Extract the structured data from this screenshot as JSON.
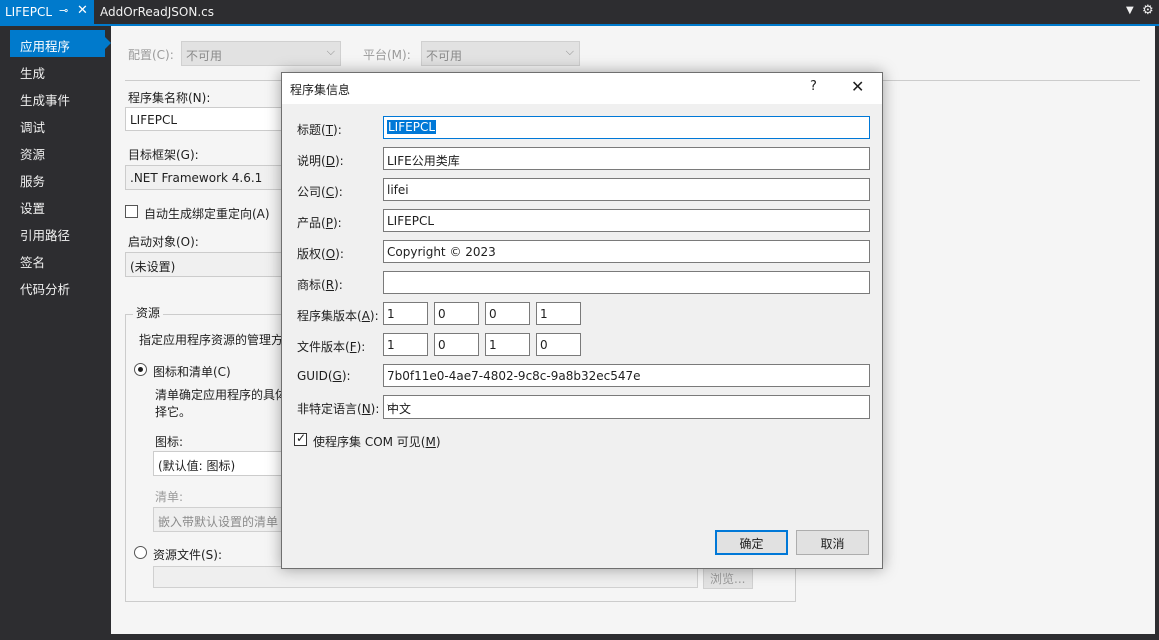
{
  "tabs": {
    "active_label": "LIFEPCL",
    "inactive_label": "AddOrReadJSON.cs"
  },
  "nav": {
    "items": [
      "应用程序",
      "生成",
      "生成事件",
      "调试",
      "资源",
      "服务",
      "设置",
      "引用路径",
      "签名",
      "代码分析"
    ]
  },
  "page": {
    "config_label": "配置(C):",
    "config_value": "不可用",
    "platform_label": "平台(M):",
    "platform_value": "不可用",
    "assembly_name_label": "程序集名称(N):",
    "assembly_name_value": "LIFEPCL",
    "target_framework_label": "目标框架(G):",
    "target_framework_value": ".NET Framework 4.6.1",
    "auto_binding_label": "自动生成绑定重定向(A)",
    "startup_object_label": "启动对象(O):",
    "startup_object_value": "(未设置)",
    "resources_group_title": "资源",
    "resources_desc": "指定应用程序资源的管理方",
    "icon_manifest_label": "图标和清单(C)",
    "icon_manifest_desc_line1": "清单确定应用程序的具体",
    "icon_manifest_desc_line2": "择它。",
    "icon_label": "图标:",
    "icon_value": "(默认值: 图标)",
    "manifest_label": "清单:",
    "manifest_value": "嵌入带默认设置的清单",
    "resource_file_label": "资源文件(S):",
    "browse_label": "浏览..."
  },
  "dialog": {
    "title": "程序集信息",
    "help_label": "?",
    "fields": {
      "title": {
        "pre": "标题(",
        "key": "T",
        "post": "):",
        "value": "LIFEPCL"
      },
      "description": {
        "pre": "说明(",
        "key": "D",
        "post": "):",
        "value": "LIFE公用类库"
      },
      "company": {
        "pre": "公司(",
        "key": "C",
        "post": "):",
        "value": "lifei"
      },
      "product": {
        "pre": "产品(",
        "key": "P",
        "post": "):",
        "value": "LIFEPCL"
      },
      "copyright": {
        "pre": "版权(",
        "key": "O",
        "post": "):",
        "value": "Copyright ©  2023"
      },
      "trademark": {
        "pre": "商标(",
        "key": "R",
        "post": "):",
        "value": ""
      },
      "guid": {
        "pre": "GUID(",
        "key": "G",
        "post": "):",
        "value": "7b0f11e0-4ae7-4802-9c8c-9a8b32ec547e"
      },
      "neutral_language": {
        "pre": "非特定语言(",
        "key": "N",
        "post": "):",
        "value": "中文"
      }
    },
    "assembly_version": {
      "pre": "程序集版本(",
      "key": "A",
      "post": "):",
      "values": [
        "1",
        "0",
        "0",
        "1"
      ]
    },
    "file_version": {
      "pre": "文件版本(",
      "key": "F",
      "post": "):",
      "values": [
        "1",
        "0",
        "1",
        "0"
      ]
    },
    "com_visible": {
      "pre": "使程序集 COM 可见(",
      "key": "M",
      "post": ")",
      "checked": true
    },
    "ok_label": "确定",
    "cancel_label": "取消"
  }
}
